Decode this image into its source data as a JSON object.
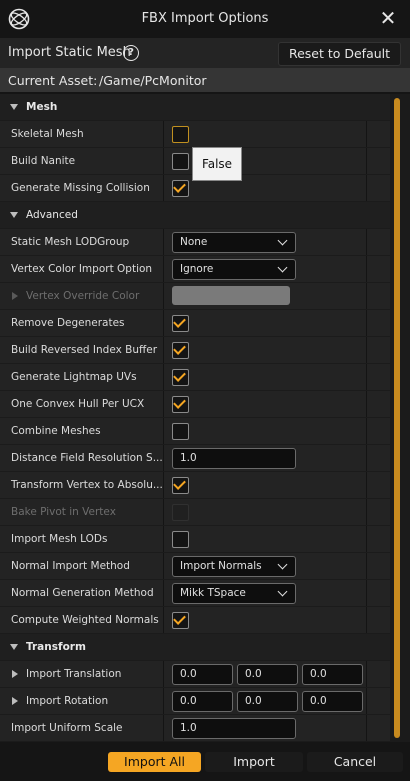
{
  "window": {
    "title": "FBX Import Options",
    "logo_icon": "unreal-logo",
    "close_icon": "close-icon"
  },
  "header": {
    "label": "Import Static Mesh",
    "reset_label": "Reset to Default"
  },
  "asset": {
    "label": "Current Asset:",
    "value": "/Game/PcMonitor"
  },
  "tooltip": "False",
  "accent": "#f5a623",
  "rows": {
    "mesh": "Mesh",
    "skeletal_mesh": {
      "label": "Skeletal Mesh",
      "checked": false
    },
    "build_nanite": {
      "label": "Build Nanite",
      "checked": false
    },
    "generate_missing_collision": {
      "label": "Generate Missing Collision",
      "checked": true
    },
    "advanced": "Advanced",
    "lod_group": {
      "label": "Static Mesh LODGroup",
      "value": "None"
    },
    "vertex_color_import": {
      "label": "Vertex Color Import Option",
      "value": "Ignore"
    },
    "vertex_override_color": {
      "label": "Vertex Override Color"
    },
    "remove_degenerates": {
      "label": "Remove Degenerates",
      "checked": true
    },
    "build_reversed_index": {
      "label": "Build Reversed Index Buffer",
      "checked": true
    },
    "generate_lightmap_uvs": {
      "label": "Generate Lightmap UVs",
      "checked": true
    },
    "one_convex_hull": {
      "label": "One Convex Hull Per UCX",
      "checked": true
    },
    "combine_meshes": {
      "label": "Combine Meshes",
      "checked": false
    },
    "distance_field": {
      "label": "Distance Field Resolution S...",
      "value": "1.0"
    },
    "transform_vertex": {
      "label": "Transform Vertex to Absolu...",
      "checked": true
    },
    "bake_pivot": {
      "label": "Bake Pivot in Vertex",
      "checked": false
    },
    "import_mesh_lods": {
      "label": "Import Mesh LODs",
      "checked": false
    },
    "normal_import_method": {
      "label": "Normal Import Method",
      "value": "Import Normals"
    },
    "normal_generation_method": {
      "label": "Normal Generation Method",
      "value": "Mikk TSpace"
    },
    "compute_weighted_normals": {
      "label": "Compute Weighted Normals",
      "checked": true
    },
    "transform": "Transform",
    "import_translation": {
      "label": "Import Translation",
      "x": "0.0",
      "y": "0.0",
      "z": "0.0"
    },
    "import_rotation": {
      "label": "Import Rotation",
      "x": "0.0",
      "y": "0.0",
      "z": "0.0"
    },
    "import_uniform_scale": {
      "label": "Import Uniform Scale",
      "value": "1.0"
    }
  },
  "footer": {
    "import_all": "Import All",
    "import": "Import",
    "cancel": "Cancel"
  }
}
